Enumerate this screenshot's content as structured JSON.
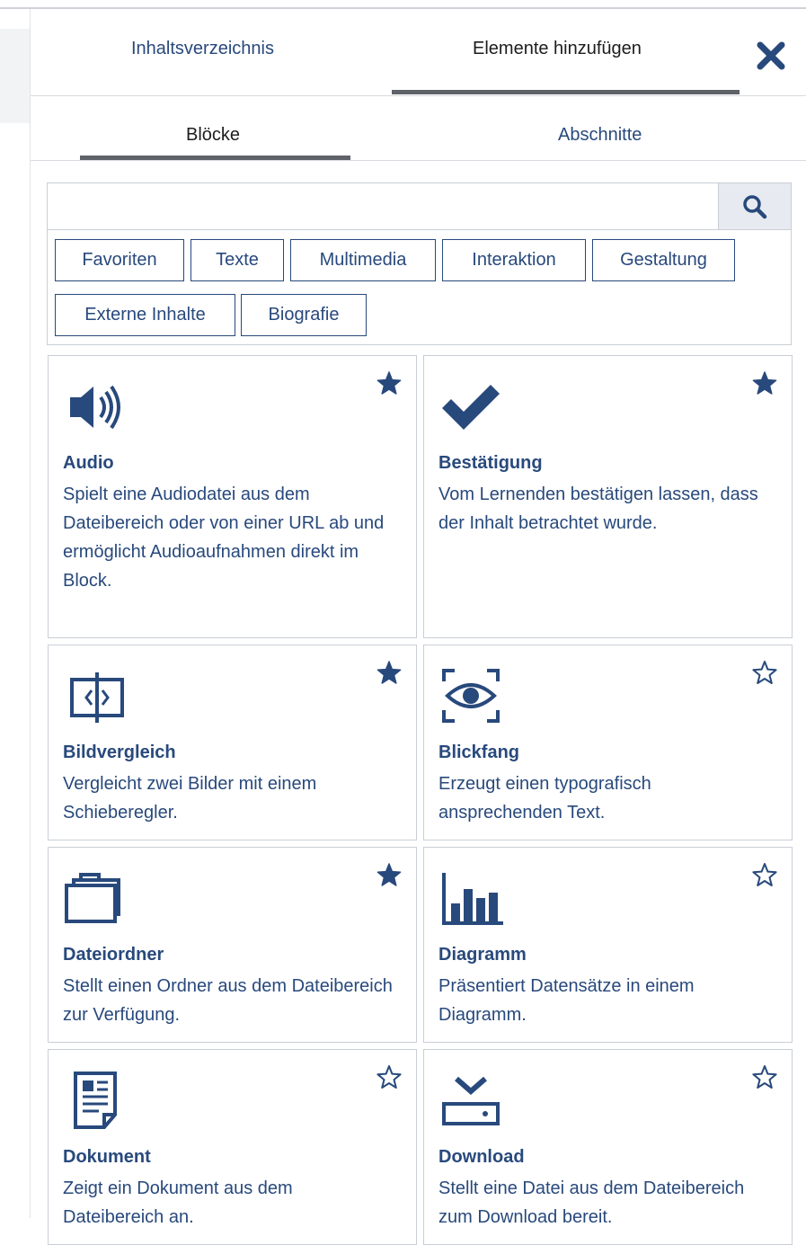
{
  "header": {
    "tab_toc": "Inhaltsverzeichnis",
    "tab_add": "Elemente hinzufügen",
    "close_icon": "close-icon"
  },
  "subtabs": {
    "blocks": "Blöcke",
    "sections": "Abschnitte"
  },
  "search": {
    "value": "",
    "placeholder": "",
    "icon": "search-icon"
  },
  "filters": [
    "Favoriten",
    "Texte",
    "Multimedia",
    "Interaktion",
    "Gestaltung",
    "Externe Inhalte",
    "Biografie"
  ],
  "blocks": [
    {
      "title": "Audio",
      "desc": "Spielt eine Audiodatei aus dem Dateibereich oder von einer URL ab und ermöglicht Audioaufnahmen direkt im Block.",
      "icon": "audio-icon",
      "favorite": true
    },
    {
      "title": "Bestätigung",
      "desc": "Vom Lernenden bestätigen lassen, dass der Inhalt betrachtet wurde.",
      "icon": "checkmark-icon",
      "favorite": true
    },
    {
      "title": "Bildvergleich",
      "desc": "Vergleicht zwei Bilder mit einem Schieberegler.",
      "icon": "image-compare-icon",
      "favorite": true
    },
    {
      "title": "Blickfang",
      "desc": "Erzeugt einen typografisch ansprechenden Text.",
      "icon": "eye-icon",
      "favorite": false
    },
    {
      "title": "Dateiordner",
      "desc": "Stellt einen Ordner aus dem Dateibereich zur Verfügung.",
      "icon": "folder-icon",
      "favorite": true
    },
    {
      "title": "Diagramm",
      "desc": "Präsentiert Datensätze in einem Diagramm.",
      "icon": "bar-chart-icon",
      "favorite": false
    },
    {
      "title": "Dokument",
      "desc": "Zeigt ein Dokument aus dem Dateibereich an.",
      "icon": "document-icon",
      "favorite": false
    },
    {
      "title": "Download",
      "desc": "Stellt eine Datei aus dem Dateibereich zum Download bereit.",
      "icon": "download-icon",
      "favorite": false
    }
  ],
  "colors": {
    "primary": "#28497c",
    "border": "#c9ced6",
    "active_tab_underline": "#5f6268",
    "search_button_bg": "#e7ebf1"
  }
}
